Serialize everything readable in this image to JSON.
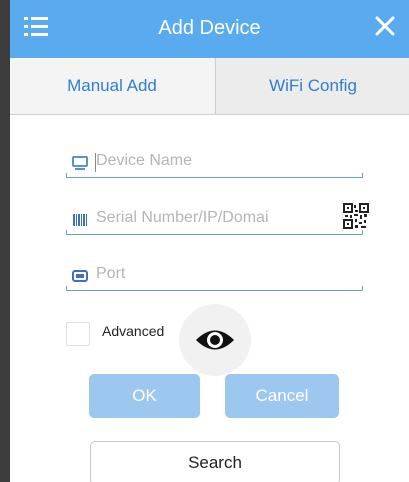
{
  "header": {
    "title": "Add Device",
    "menu_icon": "menu-icon",
    "close_icon": "close-icon",
    "color": "#5aaaf0"
  },
  "tabs": [
    {
      "label": "Manual Add",
      "active": true
    },
    {
      "label": "WiFi Config",
      "active": false
    }
  ],
  "form": {
    "device_name_placeholder": "Device Name",
    "serial_placeholder": "Serial Number/IP/Domai",
    "port_placeholder": "Port",
    "advanced_label": "Advanced",
    "advanced_checked": false
  },
  "buttons": {
    "ok": "OK",
    "cancel": "Cancel",
    "search": "Search"
  },
  "accent_color": "#2f7fd0"
}
